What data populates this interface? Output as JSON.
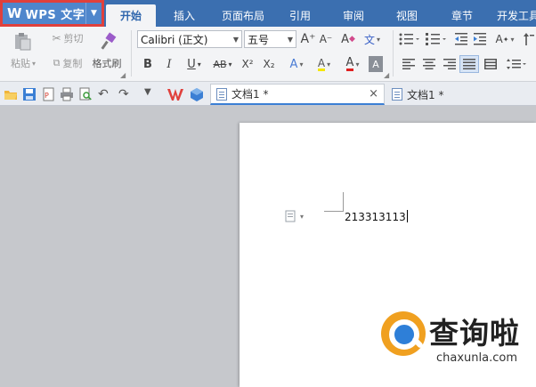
{
  "app": {
    "title": "WPS 文字",
    "logo": "W"
  },
  "menu": {
    "tabs": [
      {
        "label": "开始",
        "active": true
      },
      {
        "label": "插入"
      },
      {
        "label": "页面布局"
      },
      {
        "label": "引用"
      },
      {
        "label": "审阅"
      },
      {
        "label": "视图"
      },
      {
        "label": "章节"
      },
      {
        "label": "开发工具"
      }
    ]
  },
  "ribbon": {
    "cut": "剪切",
    "paste": "粘贴",
    "copy": "复制",
    "format_painter": "格式刷",
    "font_name": "Calibri (正文)",
    "font_size": "五号",
    "bold": "B",
    "italic": "I",
    "underline": "U",
    "strike": "AB",
    "superscript": "X²",
    "subscript": "X₂",
    "font_color": "A",
    "highlight": "A",
    "grow": "A⁺",
    "shrink": "A⁻",
    "clear": "A",
    "phonetic": "文"
  },
  "quick_access": {
    "doc_tabs": [
      {
        "label": "文档1 *",
        "active": true
      },
      {
        "label": "文档1 *",
        "active": false
      }
    ],
    "close_glyph": "×"
  },
  "document": {
    "text": "213313113"
  },
  "watermark": {
    "title": "查询啦",
    "url": "chaxunla.com"
  },
  "colors": {
    "title_bar": "#3b6fb0",
    "app_button": "#4f86cc",
    "highlight_box": "#e0403c",
    "ribbon": "#f3f4f6"
  }
}
